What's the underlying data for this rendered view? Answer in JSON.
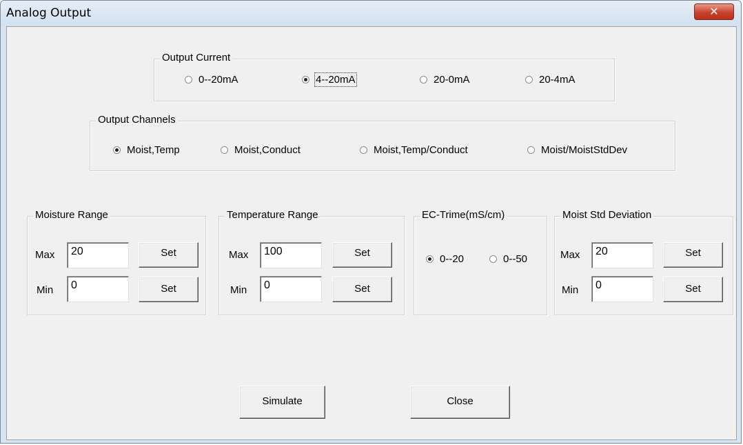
{
  "window": {
    "title": "Analog Output",
    "close_glyph": "✕"
  },
  "output_current": {
    "legend": "Output Current",
    "options": [
      "0--20mA",
      "4--20mA",
      "20-0mA",
      "20-4mA"
    ],
    "selected": "4--20mA"
  },
  "output_channels": {
    "legend": "Output Channels",
    "options": [
      "Moist,Temp",
      "Moist,Conduct",
      "Moist,Temp/Conduct",
      "Moist/MoistStdDev"
    ],
    "selected": "Moist,Temp"
  },
  "moisture_range": {
    "legend": "Moisture Range",
    "max_label": "Max",
    "max_value": "20",
    "min_label": "Min",
    "min_value": "0",
    "set_label": "Set"
  },
  "temperature_range": {
    "legend": "Temperature Range",
    "max_label": "Max",
    "max_value": "100",
    "min_label": "Min",
    "min_value": "0",
    "set_label": "Set"
  },
  "ec_trime": {
    "legend": "EC-Trime(mS/cm)",
    "options": [
      "0--20",
      "0--50"
    ],
    "selected": "0--20"
  },
  "moist_std_deviation": {
    "legend": "Moist Std Deviation",
    "max_label": "Max",
    "max_value": "20",
    "min_label": "Min",
    "min_value": "0",
    "set_label": "Set"
  },
  "actions": {
    "simulate_label": "Simulate",
    "close_label": "Close"
  }
}
